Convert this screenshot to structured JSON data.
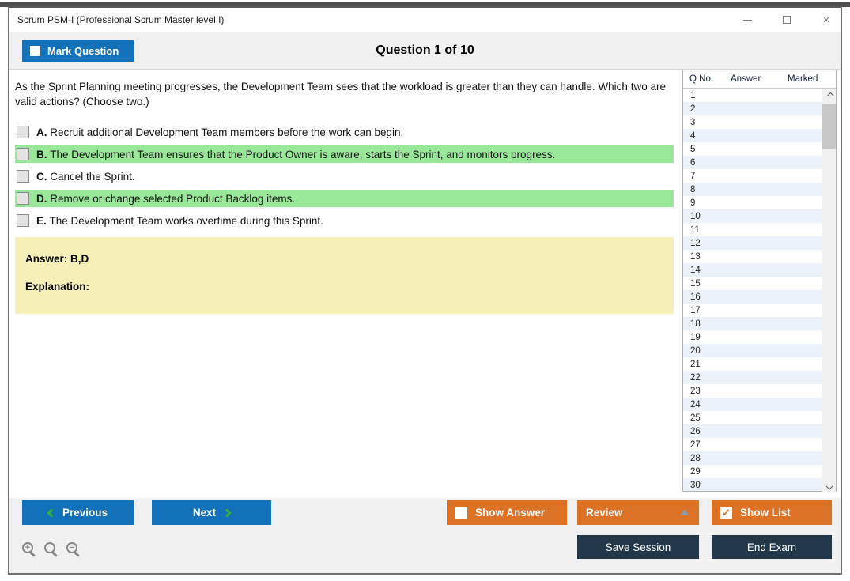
{
  "window": {
    "title": "Scrum PSM-I (Professional Scrum Master level I)",
    "controls": {
      "close_glyph": "×"
    }
  },
  "header": {
    "mark_question_label": "Mark Question",
    "question_counter": "Question 1 of 10"
  },
  "question": {
    "text": "As the Sprint Planning meeting progresses, the Development Team sees that the workload is greater than they can handle. Which two are valid actions? (Choose two.)",
    "options": [
      {
        "letter": "A.",
        "text": "Recruit additional Development Team members before the work can begin.",
        "highlighted": false
      },
      {
        "letter": "B.",
        "text": "The Development Team ensures that the Product Owner is aware, starts the Sprint, and monitors progress.",
        "highlighted": true
      },
      {
        "letter": "C.",
        "text": "Cancel the Sprint.",
        "highlighted": false
      },
      {
        "letter": "D.",
        "text": "Remove or change selected Product Backlog items.",
        "highlighted": true
      },
      {
        "letter": "E.",
        "text": "The Development Team works overtime during this Sprint.",
        "highlighted": false
      }
    ]
  },
  "answer_panel": {
    "answer_label": "Answer: B,D",
    "explanation_label": "Explanation:"
  },
  "question_list": {
    "columns": {
      "q_no": "Q No.",
      "answer": "Answer",
      "marked": "Marked"
    },
    "rows": [
      {
        "q": "1",
        "answer": "",
        "marked": ""
      },
      {
        "q": "2",
        "answer": "",
        "marked": ""
      },
      {
        "q": "3",
        "answer": "",
        "marked": ""
      },
      {
        "q": "4",
        "answer": "",
        "marked": ""
      },
      {
        "q": "5",
        "answer": "",
        "marked": ""
      },
      {
        "q": "6",
        "answer": "",
        "marked": ""
      },
      {
        "q": "7",
        "answer": "",
        "marked": ""
      },
      {
        "q": "8",
        "answer": "",
        "marked": ""
      },
      {
        "q": "9",
        "answer": "",
        "marked": ""
      },
      {
        "q": "10",
        "answer": "",
        "marked": ""
      },
      {
        "q": "11",
        "answer": "",
        "marked": ""
      },
      {
        "q": "12",
        "answer": "",
        "marked": ""
      },
      {
        "q": "13",
        "answer": "",
        "marked": ""
      },
      {
        "q": "14",
        "answer": "",
        "marked": ""
      },
      {
        "q": "15",
        "answer": "",
        "marked": ""
      },
      {
        "q": "16",
        "answer": "",
        "marked": ""
      },
      {
        "q": "17",
        "answer": "",
        "marked": ""
      },
      {
        "q": "18",
        "answer": "",
        "marked": ""
      },
      {
        "q": "19",
        "answer": "",
        "marked": ""
      },
      {
        "q": "20",
        "answer": "",
        "marked": ""
      },
      {
        "q": "21",
        "answer": "",
        "marked": ""
      },
      {
        "q": "22",
        "answer": "",
        "marked": ""
      },
      {
        "q": "23",
        "answer": "",
        "marked": ""
      },
      {
        "q": "24",
        "answer": "",
        "marked": ""
      },
      {
        "q": "25",
        "answer": "",
        "marked": ""
      },
      {
        "q": "26",
        "answer": "",
        "marked": ""
      },
      {
        "q": "27",
        "answer": "",
        "marked": ""
      },
      {
        "q": "28",
        "answer": "",
        "marked": ""
      },
      {
        "q": "29",
        "answer": "",
        "marked": ""
      },
      {
        "q": "30",
        "answer": "",
        "marked": ""
      }
    ]
  },
  "footer": {
    "previous_label": "Previous",
    "next_label": "Next",
    "show_answer_label": "Show Answer",
    "review_label": "Review",
    "show_list_label": "Show List",
    "show_list_check_glyph": "✓",
    "save_session_label": "Save Session",
    "end_exam_label": "End Exam",
    "zoom_in_glyph": "+",
    "zoom_out_glyph": "−"
  },
  "colors": {
    "accent_blue": "#1271b8",
    "accent_orange": "#dc7226",
    "accent_navy": "#203849",
    "highlight_green": "#99e899",
    "answer_yellow": "#f6f0b8",
    "row_stripe_blue": "#eaf1f8",
    "chevron_green": "#37b034"
  }
}
